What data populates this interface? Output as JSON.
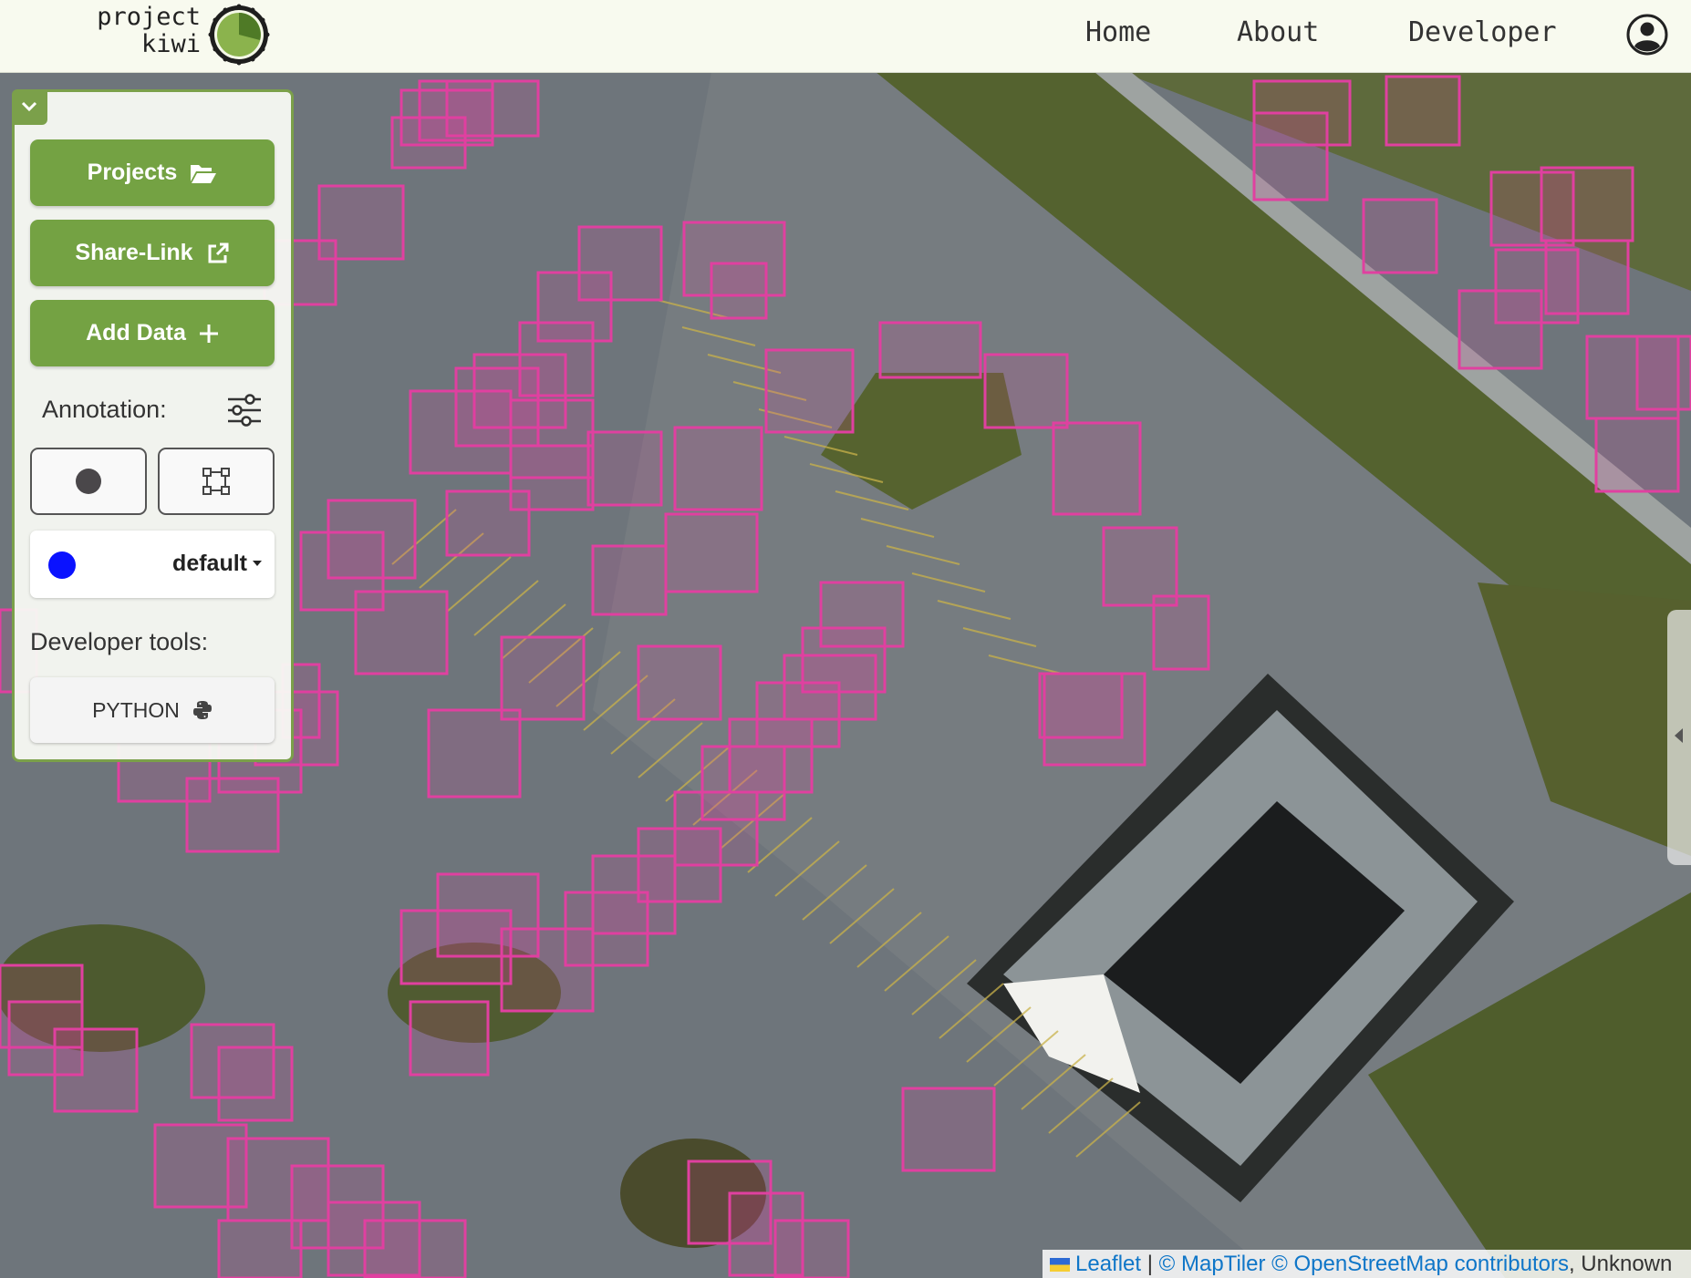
{
  "header": {
    "logo_line1": "project",
    "logo_line2": "kiwi",
    "nav": [
      {
        "label": "Home"
      },
      {
        "label": "About"
      },
      {
        "label": "Developer"
      }
    ],
    "user_icon": "user-circle-icon"
  },
  "panel": {
    "collapse_icon": "chevron-down-icon",
    "projects_label": "Projects",
    "sharelink_label": "Share-Link",
    "adddata_label": "Add Data",
    "annotation_label": "Annotation:",
    "tools": [
      "point-tool-icon",
      "bounding-box-tool-icon"
    ],
    "class_selector": {
      "color": "#0a12ff",
      "value": "default"
    },
    "developer_tools_label": "Developer tools:",
    "python_label": "PYTHON"
  },
  "map": {
    "attribution": {
      "leaflet": "Leaflet",
      "separator": "|",
      "maptiler": "© MapTiler",
      "osm": "© OpenStreetMap contributors",
      "suffix": ", Unknown"
    },
    "annotation_color": "#e040a0"
  }
}
